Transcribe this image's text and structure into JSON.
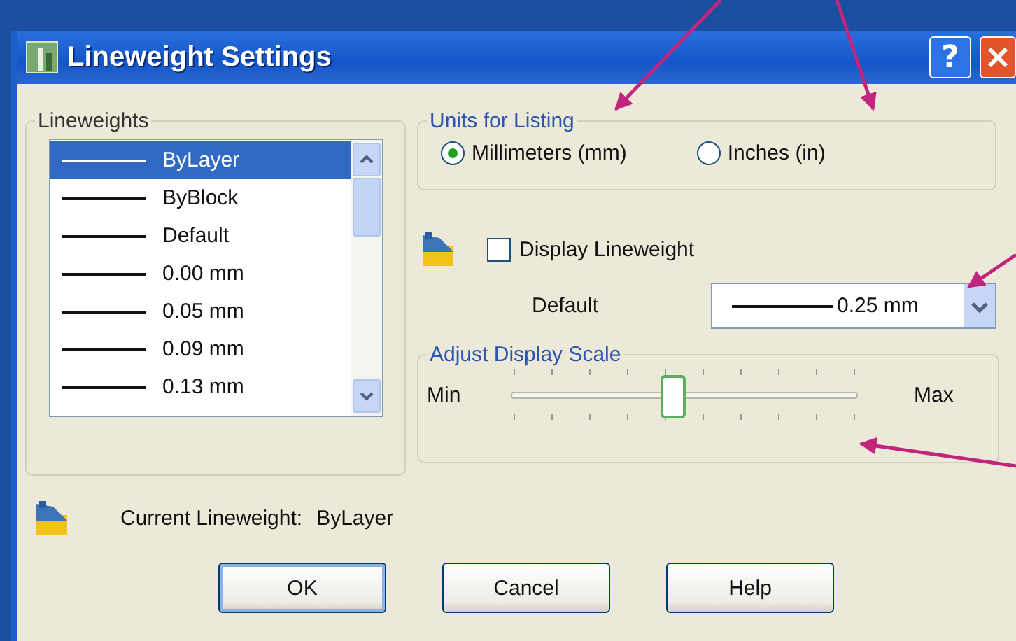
{
  "window": {
    "title": "Lineweight Settings",
    "help_glyph": "?"
  },
  "lineweights": {
    "label": "Lineweights",
    "items": [
      {
        "label": "ByLayer",
        "selected": true
      },
      {
        "label": "ByBlock",
        "selected": false
      },
      {
        "label": "Default",
        "selected": false
      },
      {
        "label": "0.00 mm",
        "selected": false
      },
      {
        "label": "0.05 mm",
        "selected": false
      },
      {
        "label": "0.09 mm",
        "selected": false
      },
      {
        "label": "0.13 mm",
        "selected": false
      }
    ]
  },
  "units": {
    "label": "Units for Listing",
    "options": [
      {
        "label": "Millimeters (mm)",
        "selected": true
      },
      {
        "label": "Inches (in)",
        "selected": false
      }
    ]
  },
  "display_lineweight": {
    "label": "Display Lineweight",
    "checked": false
  },
  "default": {
    "label": "Default",
    "value": "0.25 mm"
  },
  "scale": {
    "label": "Adjust Display Scale",
    "min_label": "Min",
    "max_label": "Max",
    "level": 0.44
  },
  "current": {
    "label": "Current Lineweight:",
    "value": "ByLayer"
  },
  "buttons": [
    "OK",
    "Cancel",
    "Help"
  ]
}
